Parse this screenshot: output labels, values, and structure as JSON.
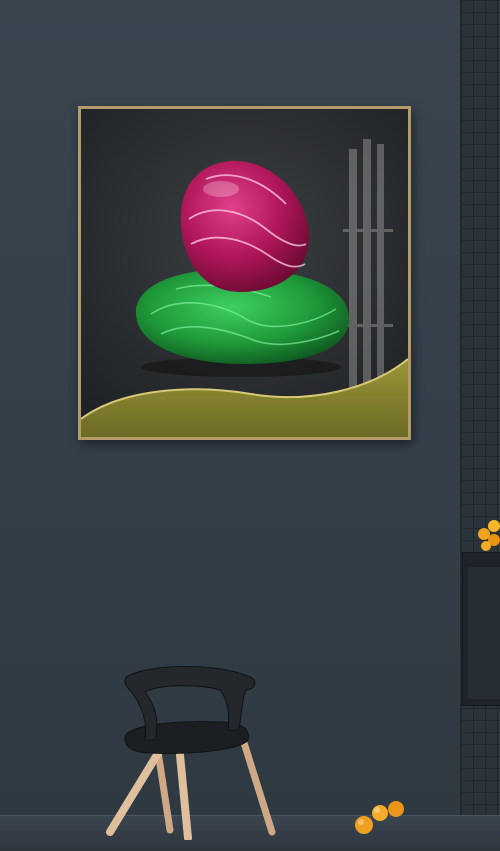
{
  "scene": {
    "subject": "framed-artwork-on-wall",
    "colors": {
      "wall": "#333d47",
      "frame_gold": "#b59a6a",
      "canvas_dark": "#2a2d30",
      "stone_magenta": "#b0165a",
      "stone_green": "#1f9a3a",
      "gold_band": "#8a8a30",
      "chair_seat": "#1c1f22",
      "chair_legs": "#d8b894",
      "balls_orange": "#f0a020"
    },
    "objects": [
      "framed-print",
      "magenta-agate-stone",
      "green-malachite-stone",
      "gold-wave-band",
      "black-chair",
      "orange-balls",
      "tiled-wall",
      "dark-shelf"
    ]
  }
}
